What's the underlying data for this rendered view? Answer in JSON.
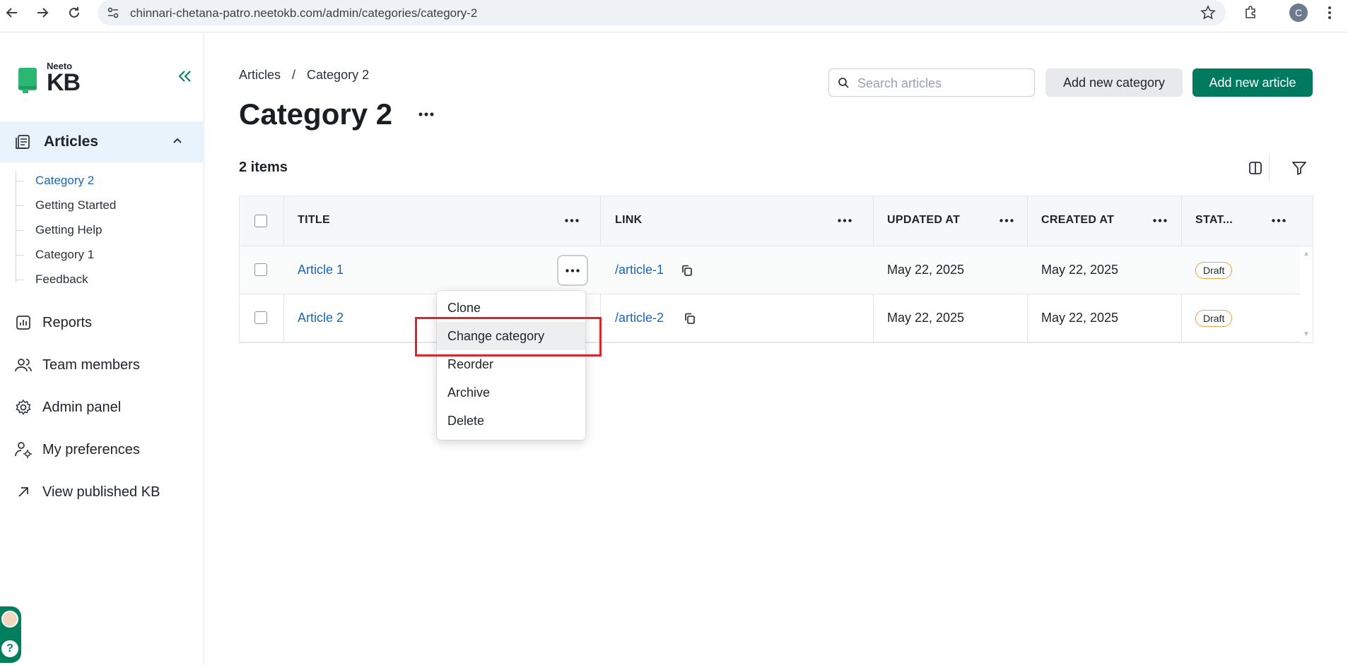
{
  "browser": {
    "url": "chinnari-chetana-patro.neetokb.com/admin/categories/category-2",
    "profile_initial": "C"
  },
  "sidebar": {
    "logo_small": "Neeto",
    "logo_big": "KB",
    "articles_label": "Articles",
    "categories": [
      {
        "label": "Category 2",
        "active": true
      },
      {
        "label": "Getting Started",
        "active": false
      },
      {
        "label": "Getting Help",
        "active": false
      },
      {
        "label": "Category 1",
        "active": false
      },
      {
        "label": "Feedback",
        "active": false
      }
    ],
    "nav": [
      {
        "label": "Reports",
        "icon": "chart-icon"
      },
      {
        "label": "Team members",
        "icon": "users-icon"
      },
      {
        "label": "Admin panel",
        "icon": "gear-icon"
      },
      {
        "label": "My preferences",
        "icon": "user-settings-icon"
      },
      {
        "label": "View published KB",
        "icon": "external-arrow-icon"
      }
    ],
    "help_widget": "?"
  },
  "header": {
    "breadcrumb": [
      "Articles",
      "/",
      "Category 2"
    ],
    "title": "Category 2",
    "search_placeholder": "Search articles",
    "add_category_label": "Add new category",
    "add_article_label": "Add new article"
  },
  "list": {
    "count_label": "2 items",
    "columns": [
      "TITLE",
      "LINK",
      "UPDATED AT",
      "CREATED AT",
      "STAT..."
    ],
    "rows": [
      {
        "title": "Article 1",
        "link": "/article-1",
        "updated_at": "May 22, 2025",
        "created_at": "May 22, 2025",
        "status": "Draft"
      },
      {
        "title": "Article 2",
        "link": "/article-2",
        "updated_at": "May 22, 2025",
        "created_at": "May 22, 2025",
        "status": "Draft"
      }
    ]
  },
  "dropdown": {
    "items": [
      "Clone",
      "Change category",
      "Reorder",
      "Archive",
      "Delete"
    ],
    "hovered_index": 1
  },
  "colors": {
    "primary": "#007a5e",
    "link": "#1a66b8",
    "active_bg": "#e8f3fb",
    "draft_badge_border": "#f0a24a",
    "highlight": "#d9252b"
  }
}
